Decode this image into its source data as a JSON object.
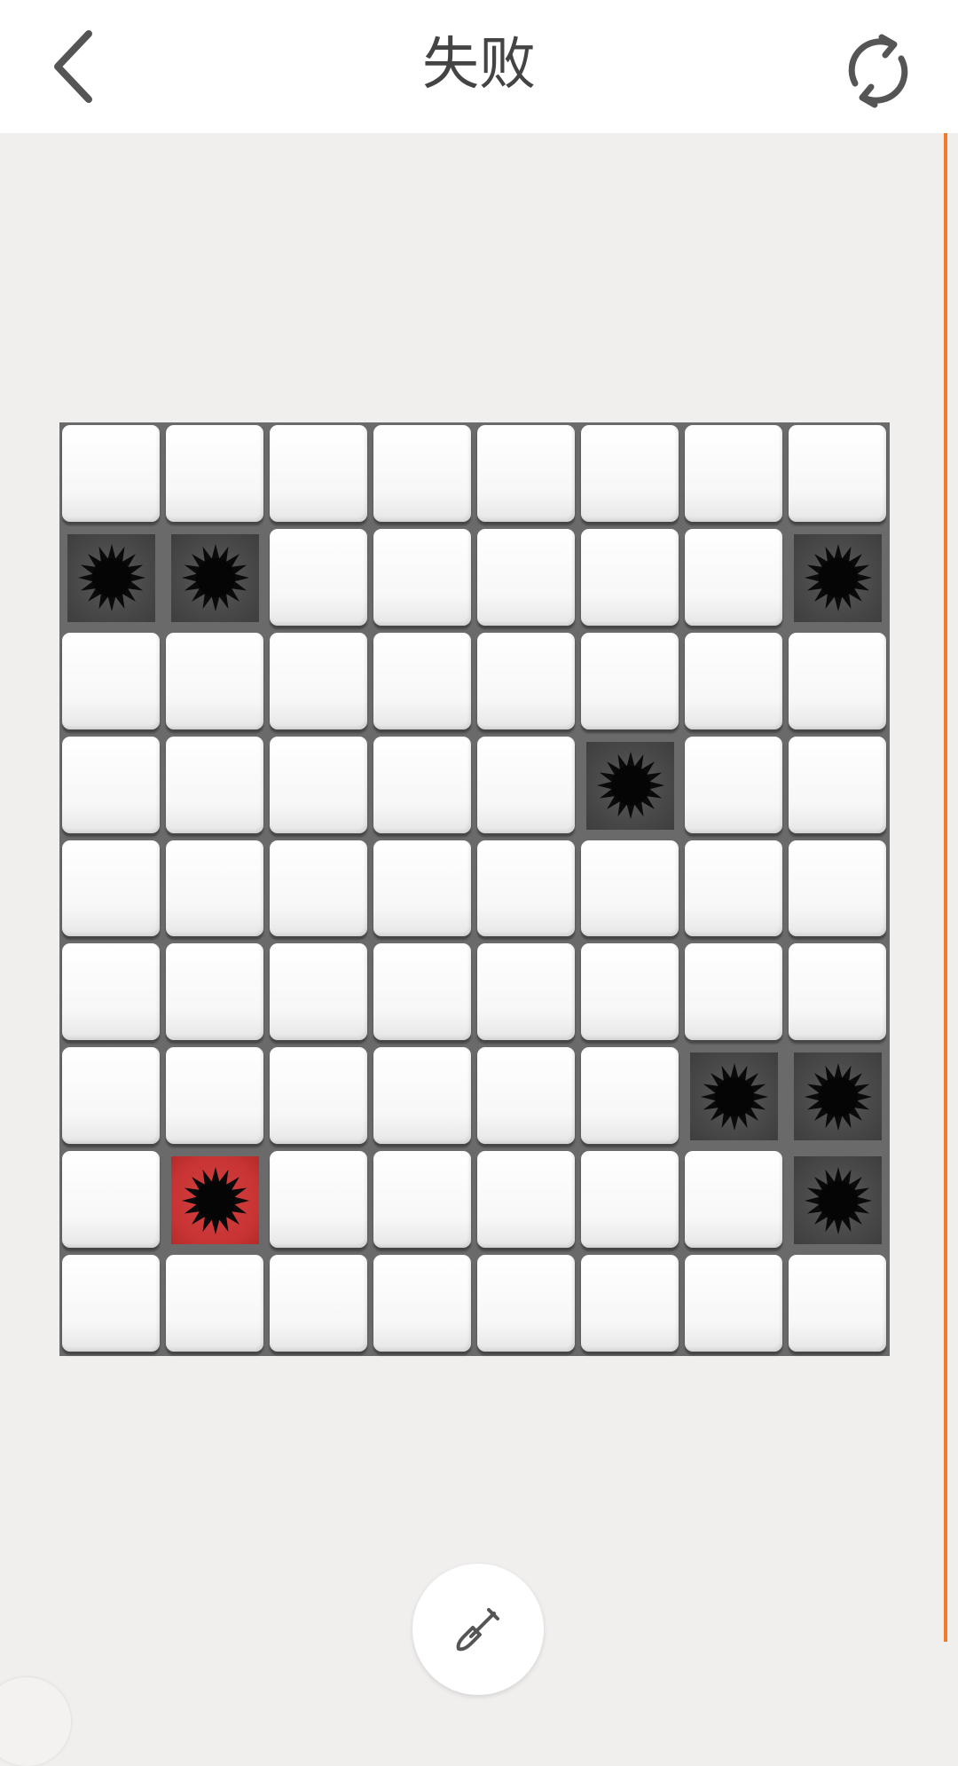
{
  "header": {
    "title": "失败",
    "back_icon": "chevron-left-icon",
    "restart_icon": "refresh-icon"
  },
  "board": {
    "rows": 9,
    "cols": 8,
    "mines": [
      [
        1,
        0
      ],
      [
        1,
        1
      ],
      [
        1,
        7
      ],
      [
        3,
        5
      ],
      [
        6,
        6
      ],
      [
        6,
        7
      ],
      [
        7,
        7
      ]
    ],
    "exploded": [
      7,
      1
    ]
  },
  "footer": {
    "dig_icon": "shovel-icon"
  },
  "colors": {
    "accent": "#f07c2a",
    "exploded": "#c83434",
    "mine_bg": "#4a4a4a",
    "grid": "#6a6a6a"
  }
}
